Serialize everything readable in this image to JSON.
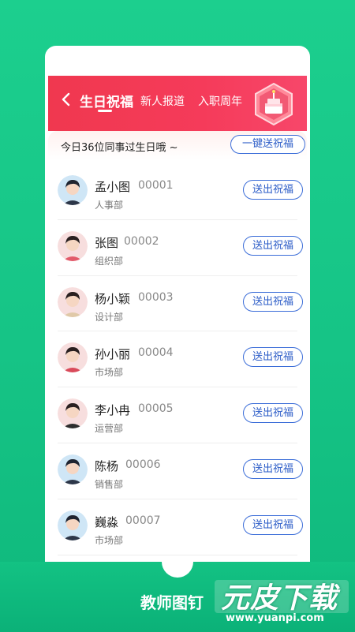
{
  "header": {
    "tabs": [
      "生日祝福",
      "新人报道",
      "入职周年"
    ],
    "active_tab_index": 0
  },
  "subbar": {
    "text": "今日36位同事过生日哦 ~",
    "button_label": "一键送祝福"
  },
  "employees": [
    {
      "name": "孟小图",
      "id": "00001",
      "dept": "人事部",
      "button": "送出祝福"
    },
    {
      "name": "张图",
      "id": "00002",
      "dept": "组织部",
      "button": "送出祝福"
    },
    {
      "name": "杨小颖",
      "id": "00003",
      "dept": "设计部",
      "button": "送出祝福"
    },
    {
      "name": "孙小丽",
      "id": "00004",
      "dept": "市场部",
      "button": "送出祝福"
    },
    {
      "name": "李小冉",
      "id": "00005",
      "dept": "运营部",
      "button": "送出祝福"
    },
    {
      "name": "陈杨",
      "id": "00006",
      "dept": "销售部",
      "button": "送出祝福"
    },
    {
      "name": "巍淼",
      "id": "00007",
      "dept": "市场部",
      "button": "送出祝福"
    }
  ],
  "footer": {
    "app_name": "教师图钉",
    "watermark_title": "元皮下载",
    "watermark_url": "www.yuanpi.com"
  },
  "colors": {
    "brand_green": "#16c486",
    "header_red": "#f0384f",
    "button_blue": "#3b6dd8"
  }
}
